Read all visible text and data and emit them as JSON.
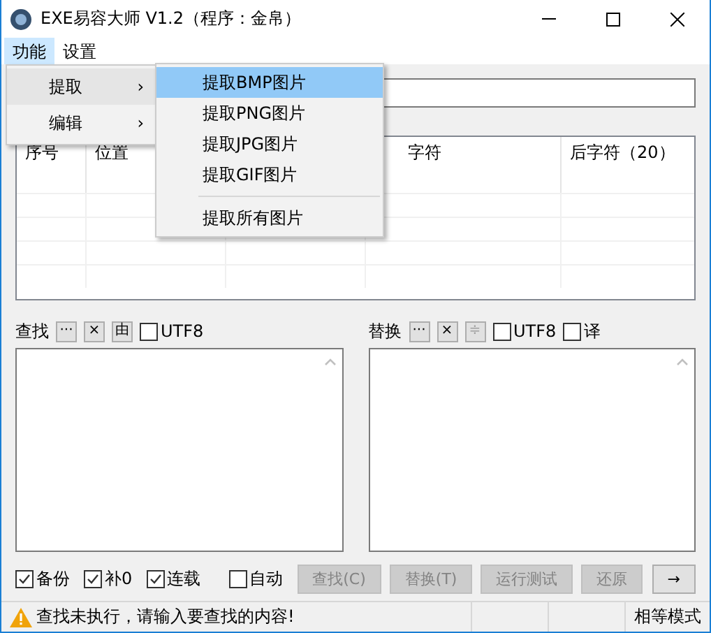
{
  "window": {
    "title": "EXE易容大师 V1.2（程序：金帛）"
  },
  "menu_bar": [
    {
      "label": "功能",
      "selected": true
    },
    {
      "label": "设置",
      "selected": false
    }
  ],
  "menu": [
    {
      "label": "提取",
      "selected": true,
      "arrow": "›"
    },
    {
      "label": "编辑",
      "selected": false,
      "arrow": "›"
    }
  ],
  "submenu": [
    {
      "items": [
        {
          "label": "提取BMP图片",
          "selected": true
        },
        {
          "label": "提取PNG图片",
          "selected": false
        },
        {
          "label": "提取JPG图片",
          "selected": false
        },
        {
          "label": "提取GIF图片",
          "selected": false
        }
      ]
    },
    {
      "items": [
        {
          "label": "提取所有图片",
          "selected": false
        }
      ]
    }
  ],
  "table": {
    "columns": [
      "序号",
      "位置",
      "字符",
      "后字符（20）"
    ]
  },
  "find": {
    "label": "查找",
    "tools": [
      {
        "label": "···",
        "disabled": false
      },
      {
        "label": "×",
        "disabled": false
      },
      {
        "label": "由",
        "disabled": false
      }
    ],
    "options": [
      {
        "label": "UTF8",
        "checked": false
      }
    ]
  },
  "replace": {
    "label": "替换",
    "tools": [
      {
        "label": "···",
        "disabled": false
      },
      {
        "label": "×",
        "disabled": false
      },
      {
        "label": "≑",
        "disabled": true
      }
    ],
    "options": [
      {
        "label": "UTF8",
        "checked": false
      },
      {
        "label": "译",
        "checked": false
      }
    ]
  },
  "options": [
    {
      "label": "备份",
      "checked": true
    },
    {
      "label": "补0",
      "checked": true
    },
    {
      "label": "连载",
      "checked": true
    },
    {
      "label": "自动",
      "checked": false
    }
  ],
  "buttons": [
    {
      "label": "查找(C)",
      "disabled": true
    },
    {
      "label": "替换(T)",
      "disabled": true
    },
    {
      "label": "运行测试",
      "disabled": true
    },
    {
      "label": "还原",
      "disabled": true
    },
    {
      "label": "→",
      "disabled": false
    }
  ],
  "status_bar": {
    "message": "查找未执行，请输入要查找的内容!",
    "mode": "相等模式"
  }
}
